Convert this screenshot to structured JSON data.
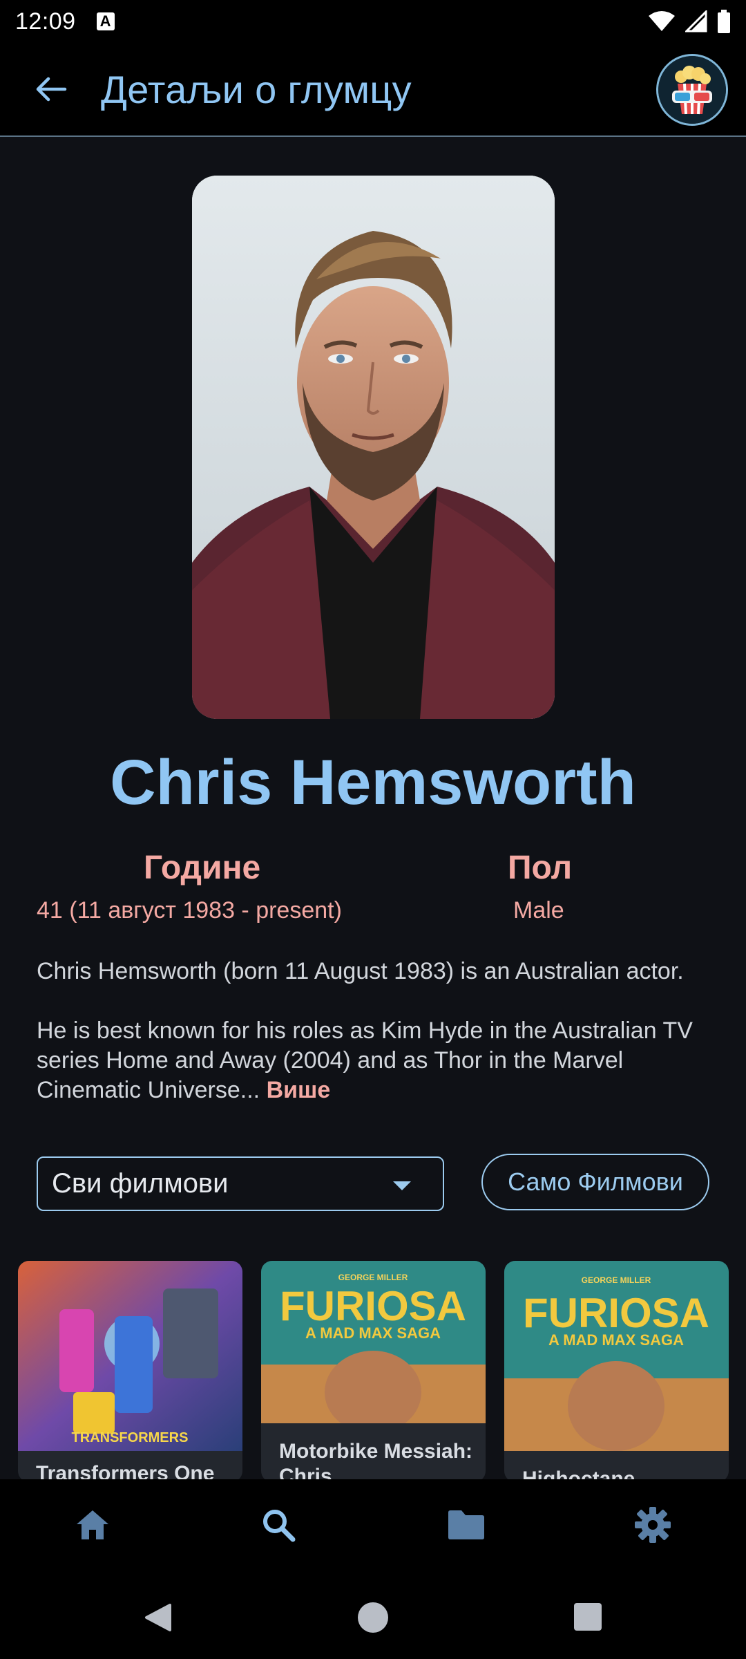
{
  "status_bar": {
    "time": "12:09",
    "badge": "A"
  },
  "app_bar": {
    "title": "Детаљи о глумцу"
  },
  "actor": {
    "name": "Chris Hemsworth",
    "age_label": "Године",
    "age_value": "41 (11 август 1983 - present)",
    "gender_label": "Пол",
    "gender_value": "Male",
    "bio_p1": "Chris Hemsworth (born 11 August 1983) is an Australian actor.",
    "bio_p2": "He is best known for his roles as Kim Hyde in the Australian TV series Home and Away (2004) and as Thor in the Marvel Cinematic Universe...",
    "more_label": "Више"
  },
  "filters": {
    "dropdown_value": "Сви филмови",
    "toggle_label": "Само Филмови"
  },
  "movies": [
    {
      "title": "Transformers One",
      "poster_text": "TRANSFORMERS"
    },
    {
      "title": "Motorbike Messiah: Chris",
      "poster_title": "FURIOSA",
      "poster_subtitle": "A MAD MAX SAGA",
      "poster_director": "GEORGE MILLER"
    },
    {
      "title": "Highoctane",
      "poster_title": "FURIOSA",
      "poster_subtitle": "A MAD MAX SAGA",
      "poster_director": "GEORGE MILLER"
    }
  ],
  "icons": {
    "back": "arrow-left-icon",
    "logo": "popcorn-3d-glasses-logo",
    "nav": [
      "home-icon",
      "search-icon",
      "folder-icon",
      "settings-icon"
    ],
    "system": [
      "back-triangle-icon",
      "home-circle-icon",
      "recents-square-icon"
    ]
  },
  "colors": {
    "accent_blue": "#90c6f3",
    "accent_pink": "#f4a9a3",
    "background": "#0f1116",
    "nav_icon": "#5a7fa6",
    "nav_icon_active": "#8fc3ee"
  }
}
